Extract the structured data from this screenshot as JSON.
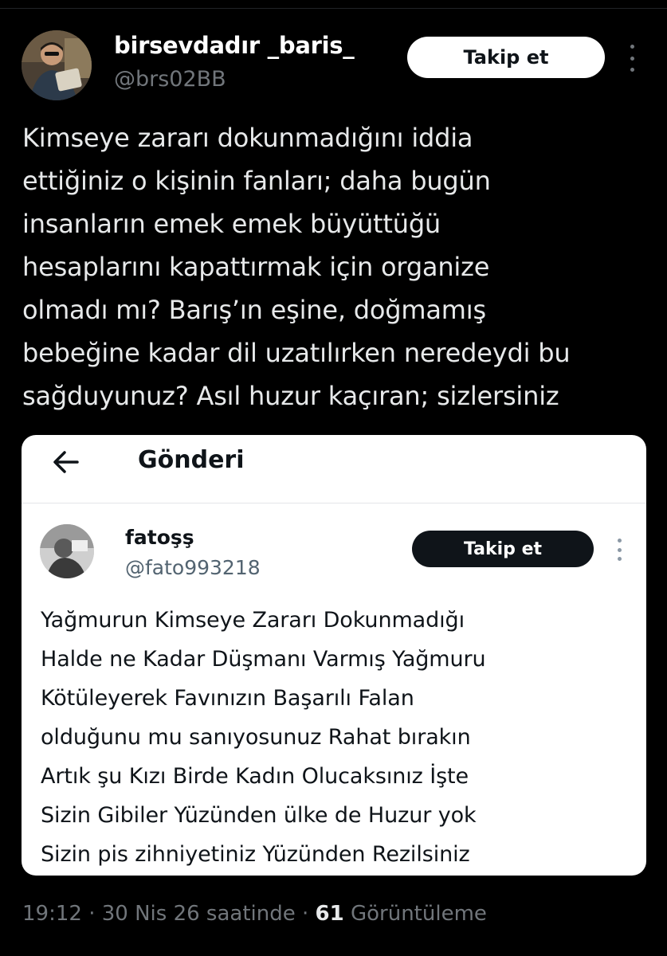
{
  "tweet": {
    "display_name": "birsevdadır _baris_",
    "handle": "@brs02BB",
    "follow_label": "Takip et",
    "text": "Kimseye zararı dokunmadığını iddia\nettiğiniz o kişinin fanları; daha bugün\ninsanların emek emek büyüttüğü\nhesaplarını kapattırmak için organize\nolmadı mı? Barış’ın eşine, doğmamış\nbebeğine kadar dil uzatılırken neredeydi bu\nsağduyunuz? Asıl huzur kaçıran; sizlersiniz",
    "time": "19:12",
    "date": "30 Nis 26 saatinde",
    "view_count": "61",
    "view_label": "Görüntüleme",
    "separator": " · ",
    "icons": [
      "avatar-photo",
      "more-vertical-icon"
    ]
  },
  "embedded": {
    "header_title": "Gönderi",
    "back_icon": "arrow-left-icon",
    "author": {
      "name": "fatoşş",
      "handle": "@fato993218",
      "follow_label": "Takip et"
    },
    "text": "Yağmurun Kimseye Zararı Dokunmadığı\nHalde ne Kadar Düşmanı Varmış Yağmuru\nKötüleyerek Favınızın Başarılı Falan\nolduğunu mu sanıyosunuz  Rahat bırakın\nArtık şu Kızı Birde Kadın Olucaksınız İşte\nSizin Gibiler Yüzünden ülke de Huzur yok\nSizin pis zihniyetiniz Yüzünden Rezilsiniz"
  },
  "colors": {
    "background": "#000000",
    "text_primary": "#e7e9ea",
    "text_secondary": "#71767b",
    "card_background": "#ffffff",
    "dark_button": "#0f1419"
  }
}
